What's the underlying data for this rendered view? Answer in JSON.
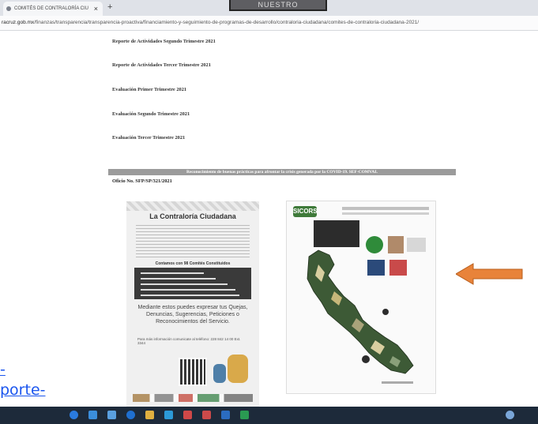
{
  "browser": {
    "tab_title": "COMITÉS DE CONTRALORÍA CIU",
    "tab_close": "×",
    "new_tab": "+",
    "top_decoration": "NUESTRO",
    "url_domain": "racruz.gob.mx",
    "url_path": "/finanzas/transparencia/transparencia-proactiva/financiamiento-y-seguimiento-de-programas-de-desarrollo/contraloria-ciudadana/comites-de-contraloria-ciudadana-2021/"
  },
  "page": {
    "reports": [
      "Reporte de Actividades Segundo Trimestre 2021",
      "Reporte de Actividades Tercer Trimestre 2021",
      "Evaluación Primer Trimestre 2021",
      "Evaluación Segundo Trimestre 2021",
      "Evaluación Tercer Trimestre 2021"
    ],
    "banner": "Reconocimiento de buenas prácticas para afrontar la crisis generada por la COVID-19. SEF-COMVAL",
    "oficio": "Oficio No. SFP/SP/321/2021"
  },
  "poster_left": {
    "title": "La Contraloría Ciudadana",
    "subtitle": "Contamos con 98 Comités Constituidos",
    "big_line1": "Mediante estos puedes expresar tus Quejas,",
    "big_line2": "Denuncias, Sugerencias, Peticiones o",
    "big_line3": "Reconocimientos del Servicio.",
    "phone": "Para más información comunicate al teléfono: 228 842 14 00 Ext. 3344"
  },
  "poster_right": {
    "logo": "SICORS"
  },
  "outer_link": {
    "line1": "-",
    "line2": "porte-"
  },
  "colors": {
    "arrow": "#e8833a",
    "arrow_stroke": "#b85f1e",
    "banner": "#9b9b9b",
    "link": "#1a55ee",
    "taskbar": "#1d2a3a"
  },
  "taskbar": {
    "icons": [
      "windows-icon",
      "search-icon",
      "task-view-icon",
      "edge-icon",
      "file-explorer-icon",
      "store-icon",
      "mail-icon",
      "photos-icon",
      "word-icon",
      "excel-icon"
    ]
  }
}
